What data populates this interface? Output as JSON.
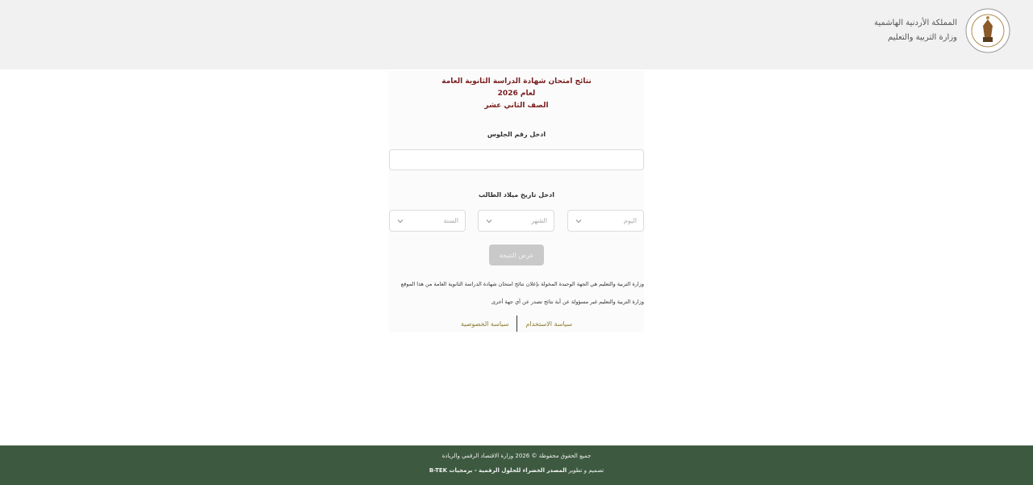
{
  "header": {
    "line1": "المملكة الأردنية الهاشمية",
    "line2": "وزارة التربية والتعليم"
  },
  "card": {
    "title_line1": "نتائج امتحان شهادة الدراسة الثانوية العامة",
    "title_line2": "لعام 2026",
    "title_line3": "الصف الثاني عشر",
    "seat_label": "ادخل رقم الجلوس",
    "seat_placeholder": "",
    "dob_label": "ادخل تاريخ ميلاد الطالب",
    "day_placeholder": "اليوم",
    "month_placeholder": "الشهر",
    "year_placeholder": "السنة",
    "show_button": "عرض النتيجة",
    "note1": "وزارة التربية والتعليم هي الجهة الوحيدة المخولة بإعلان نتائج امتحان شهادة الدراسة الثانوية العامة من هذا الموقع",
    "note2": "وزارة التربية والتعليم غير مسؤولة عن أية نتائج تصدر عن أي جهة أخرى",
    "link_usage": "سياسة الاستخدام",
    "link_privacy": "سياسة الخصوصية"
  },
  "footer": {
    "rights": "جميع الحقوق محفوظة © 2026 وزارة الاقتصاد الرقمي والريادة",
    "design_prefix": "تصميم و تطوير",
    "design_company": "المصدر الخضراء للحلول الرقمية - برمجيات B-TEK"
  },
  "colors": {
    "title": "#7a1e1e",
    "link": "#8a7a2d",
    "footer_bg": "#3d5a40",
    "header_bg": "#f1f1f1",
    "button_disabled": "#c9c9c9"
  }
}
